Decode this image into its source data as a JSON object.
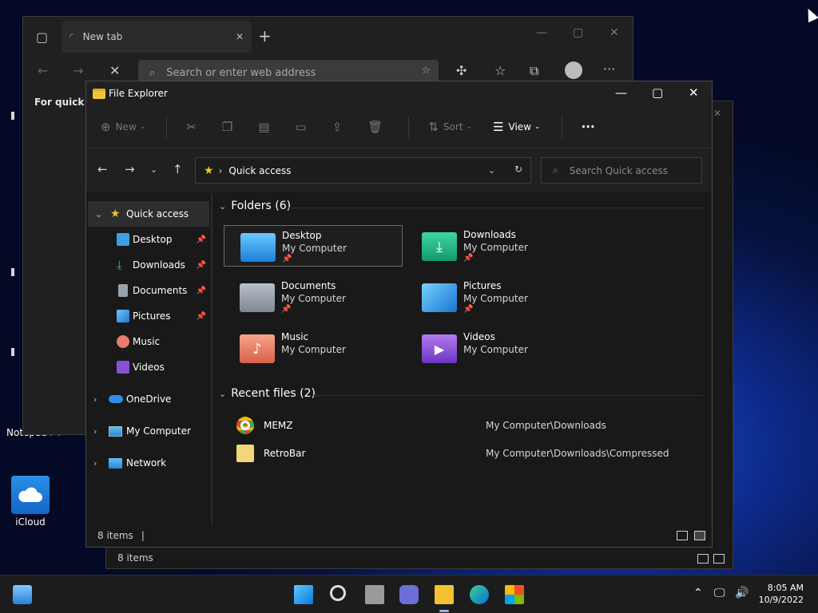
{
  "desktop": {
    "icons": [
      {
        "label": "Notepad++"
      },
      {
        "label": "iCloud"
      }
    ]
  },
  "browser": {
    "tab_title": "New tab",
    "address_placeholder": "Search or enter web address",
    "quick_links_text": "For quick ac"
  },
  "explorer": {
    "title": "File Explorer",
    "commands": {
      "new": "New",
      "sort": "Sort",
      "view": "View"
    },
    "path_crumb": "Quick access",
    "search_placeholder": "Search Quick access",
    "sidebar": {
      "quick_access": "Quick access",
      "pinned": [
        {
          "label": "Desktop",
          "icon": "desktop-icon",
          "color": "#3aa0e8",
          "pinned": true
        },
        {
          "label": "Downloads",
          "icon": "download-icon",
          "color": "#2bbf8f",
          "pinned": true
        },
        {
          "label": "Documents",
          "icon": "document-icon",
          "color": "#9aa3ad",
          "pinned": true
        },
        {
          "label": "Pictures",
          "icon": "pictures-icon",
          "color": "#3aa0e8",
          "pinned": true
        },
        {
          "label": "Music",
          "icon": "music-icon",
          "color": "#e87a6e",
          "pinned": false
        },
        {
          "label": "Videos",
          "icon": "videos-icon",
          "color": "#8b4fd6",
          "pinned": false
        }
      ],
      "roots": [
        {
          "label": "OneDrive",
          "icon": "onedrive-icon"
        },
        {
          "label": "My Computer",
          "icon": "computer-icon"
        },
        {
          "label": "Network",
          "icon": "network-icon"
        }
      ]
    },
    "folders_header": "Folders (6)",
    "folders": [
      {
        "name": "Desktop",
        "sub": "My Computer",
        "pinned": true,
        "color": "#2f95e6"
      },
      {
        "name": "Downloads",
        "sub": "My Computer",
        "pinned": true,
        "color": "#1fae7e"
      },
      {
        "name": "Documents",
        "sub": "My Computer",
        "pinned": true,
        "color": "#8d97a3"
      },
      {
        "name": "Pictures",
        "sub": "My Computer",
        "pinned": true,
        "color": "#2f95e6"
      },
      {
        "name": "Music",
        "sub": "My Computer",
        "pinned": false,
        "color": "#e07a62"
      },
      {
        "name": "Videos",
        "sub": "My Computer",
        "pinned": false,
        "color": "#8b4fd6"
      }
    ],
    "recent_header": "Recent files (2)",
    "recent": [
      {
        "name": "MEMZ",
        "location": "My Computer\\Downloads",
        "icon": "chrome-icon"
      },
      {
        "name": "RetroBar",
        "location": "My Computer\\Downloads\\Compressed",
        "icon": "archive-icon"
      }
    ],
    "status": "8 items"
  },
  "explorer_back": {
    "status": "8 items"
  },
  "taskbar": {
    "time": "8:05 AM",
    "date": "10/9/2022"
  }
}
